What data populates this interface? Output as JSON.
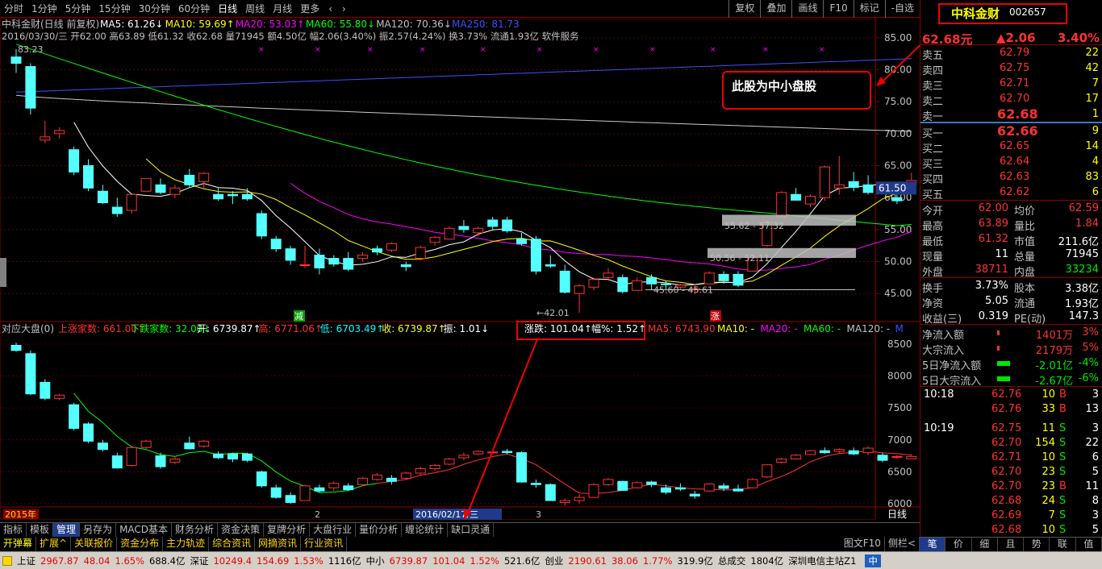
{
  "toolbar": {
    "timeframes": [
      "分时",
      "1分钟",
      "5分钟",
      "15分钟",
      "30分钟",
      "60分钟",
      "日线",
      "周线",
      "月线",
      "更多"
    ],
    "active": "日线",
    "right_buttons": [
      "复权",
      "叠加",
      "画线",
      "F10",
      "标记",
      "-自选"
    ]
  },
  "main_chart": {
    "title": "中科金财(日线 前复权)",
    "ma_labels": [
      {
        "text": "MA5: 61.26",
        "arrow": "↓",
        "color": "#ffffff"
      },
      {
        "text": "MA10: 59.69",
        "arrow": "↑",
        "color": "#ffff00"
      },
      {
        "text": "MA20: 53.03",
        "arrow": "↑",
        "color": "#ff00ff"
      },
      {
        "text": "MA60: 55.80",
        "arrow": "↓",
        "color": "#00ff00"
      },
      {
        "text": "MA120: 70.36",
        "arrow": "↓",
        "color": "#c0c0c0"
      },
      {
        "text": "MA250: 81.73",
        "arrow": "",
        "color": "#3c50ff"
      }
    ],
    "info_line": "2016/03/30/三 开62.00 高63.89 低61.32 收62.68 量71945 额4.50亿 幅2.06(3.40%) 振2.57(4.24%) 换3.73% 流通1.93亿 软件服务",
    "y_ticks": [
      "85.00",
      "80.00",
      "75.00",
      "70.00",
      "65.00",
      "60.00",
      "55.00",
      "50.00",
      "45.00"
    ],
    "price_tag": "61.50",
    "annotations": [
      "83.23",
      "42.01",
      "45.60 - 45.61",
      "50.56 - 52.11",
      "55.62 - 57.32"
    ],
    "markers": [
      "减",
      "涨"
    ],
    "callout": "此股为中小盘股"
  },
  "sub_chart": {
    "title": "对应大盘(0)",
    "stats": [
      {
        "text": "上涨家数: 661.00",
        "arrow": "↑",
        "color": "#ff3232"
      },
      {
        "text": "下跌家数: 32.00",
        "arrow": "↓",
        "color": "#00ff00"
      },
      {
        "text": "开: 6739.87",
        "arrow": "↑",
        "color": "#ffffff"
      },
      {
        "text": "高: 6771.06",
        "arrow": "↑",
        "color": "#ff3232"
      },
      {
        "text": "低: 6703.49",
        "arrow": "↑",
        "color": "#00ffff"
      },
      {
        "text": "收: 6739.87",
        "arrow": "↑",
        "color": "#ffff00"
      },
      {
        "text": "振: 1.01",
        "arrow": "↓",
        "color": "#ffffff"
      }
    ],
    "highlight": {
      "change": "涨跌: 101.04",
      "change_arrow": "↑",
      "pct": "幅%: 1.52",
      "pct_arrow": "↑"
    },
    "ma_labels": [
      {
        "text": "MA5: 6743.90",
        "color": "#ff3232"
      },
      {
        "text": "MA10: -",
        "color": "#ffff00"
      },
      {
        "text": "MA20: -",
        "color": "#ff00ff"
      },
      {
        "text": "MA60: -",
        "color": "#00ff00"
      },
      {
        "text": "MA120: -",
        "color": "#c0c0c0"
      },
      {
        "text": "M",
        "color": "#3c50ff"
      }
    ],
    "y_ticks": [
      "8500",
      "8000",
      "7500",
      "7000",
      "6500",
      "6000"
    ]
  },
  "x_axis": {
    "labels": [
      "2015年",
      "2",
      "2016/02/17/三",
      "3"
    ],
    "period": "日线"
  },
  "bottom_tabs": [
    "指标",
    "模板",
    "管理",
    "另存为",
    "MACD基本",
    "财务分析",
    "资金决策",
    "复牌分析",
    "大盘行业",
    "量价分析",
    "缠论统计",
    "缺口灵通"
  ],
  "bottom_tabs_active": "管理",
  "bottom_tabs2": [
    "开弹幕",
    "扩展^",
    "关联报价",
    "资金分布",
    "主力轨迹",
    "综合资讯",
    "网摘资讯",
    "行业资讯"
  ],
  "bottom_tabs2_right": [
    "图文F10",
    "侧栏<"
  ],
  "side_tabs": [
    "笔",
    "价",
    "细",
    "且",
    "势",
    "联",
    "值"
  ],
  "side_tabs_active": "笔",
  "side": {
    "name": "中科金财",
    "code": "002657",
    "price": "62.68元",
    "change": "▲2.06",
    "pct": "3.40%",
    "asks": [
      {
        "label": "卖五",
        "price": "62.79",
        "vol": "22"
      },
      {
        "label": "卖四",
        "price": "62.75",
        "vol": "42"
      },
      {
        "label": "卖三",
        "price": "62.71",
        "vol": "7"
      },
      {
        "label": "卖二",
        "price": "62.70",
        "vol": "17"
      },
      {
        "label": "卖一",
        "price": "62.68",
        "vol": "1"
      }
    ],
    "bids": [
      {
        "label": "买一",
        "price": "62.66",
        "vol": "9"
      },
      {
        "label": "买二",
        "price": "62.65",
        "vol": "14"
      },
      {
        "label": "买三",
        "price": "62.64",
        "vol": "4"
      },
      {
        "label": "买四",
        "price": "62.63",
        "vol": "83"
      },
      {
        "label": "买五",
        "price": "62.62",
        "vol": "6"
      }
    ],
    "stats": [
      {
        "l1": "今开",
        "v1": "62.00",
        "l2": "均价",
        "v2": "62.59",
        "c1": "red",
        "c2": "red"
      },
      {
        "l1": "最高",
        "v1": "63.89",
        "l2": "量比",
        "v2": "1.84",
        "c1": "red",
        "c2": "red"
      },
      {
        "l1": "最低",
        "v1": "61.32",
        "l2": "市值",
        "v2": "211.6亿",
        "c1": "red",
        "c2": "wht"
      },
      {
        "l1": "现量",
        "v1": "11",
        "l2": "总量",
        "v2": "71945",
        "c1": "wht",
        "c2": "wht"
      },
      {
        "l1": "外盘",
        "v1": "38711",
        "l2": "内盘",
        "v2": "33234",
        "c1": "red",
        "c2": "grn"
      }
    ],
    "stats2": [
      {
        "l1": "换手",
        "v1": "3.73%",
        "l2": "股本",
        "v2": "3.38亿"
      },
      {
        "l1": "净资",
        "v1": "5.05",
        "l2": "流通",
        "v2": "1.93亿"
      },
      {
        "l1": "收益(三)",
        "v1": "0.319",
        "l2": "PE(动)",
        "v2": "147.3"
      }
    ],
    "flows": [
      {
        "label": "净流入额",
        "value": "1401万",
        "pct": "3%",
        "color": "#ff3232"
      },
      {
        "label": "大宗流入",
        "value": "2179万",
        "pct": "5%",
        "color": "#ff3232"
      },
      {
        "label": "5日净流入额",
        "value": "-2.01亿",
        "pct": "-4%",
        "color": "#00e600"
      },
      {
        "label": "5日大宗流入",
        "value": "-2.67亿",
        "pct": "-6%",
        "color": "#00e600"
      }
    ],
    "trades": [
      {
        "time": "10:18",
        "price": "62.76",
        "vol": "10",
        "side": "B",
        "n": "3"
      },
      {
        "time": "",
        "price": "62.76",
        "vol": "33",
        "side": "B",
        "n": "13"
      },
      {
        "time": "10:19",
        "price": "62.75",
        "vol": "11",
        "side": "S",
        "n": "3"
      },
      {
        "time": "",
        "price": "62.70",
        "vol": "154",
        "side": "S",
        "n": "22"
      },
      {
        "time": "",
        "price": "62.71",
        "vol": "10",
        "side": "S",
        "n": "6"
      },
      {
        "time": "",
        "price": "62.70",
        "vol": "23",
        "side": "S",
        "n": "5"
      },
      {
        "time": "",
        "price": "62.70",
        "vol": "23",
        "side": "B",
        "n": "11"
      },
      {
        "time": "",
        "price": "62.68",
        "vol": "24",
        "side": "S",
        "n": "8"
      },
      {
        "time": "",
        "price": "62.69",
        "vol": "7",
        "side": "S",
        "n": "3"
      },
      {
        "time": "",
        "price": "62.68",
        "vol": "10",
        "side": "S",
        "n": "5"
      }
    ]
  },
  "status": {
    "sh": {
      "label": "上证",
      "price": "2967.87",
      "chg": "48.04",
      "pct": "1.65%",
      "amt": "688.4亿"
    },
    "sz": {
      "label": "深证",
      "price": "10249.4",
      "chg": "154.69",
      "pct": "1.53%",
      "amt": "1116亿"
    },
    "zx": {
      "label": "中小",
      "price": "6739.87",
      "chg": "101.04",
      "pct": "1.52%",
      "amt": "521.6亿"
    },
    "cy": {
      "label": "创业",
      "price": "2190.61",
      "chg": "38.06",
      "pct": "1.77%",
      "amt": "319.9亿"
    },
    "total_label": "总成交",
    "total": "1804亿",
    "server": "深圳电信主站Z1",
    "ime": "中"
  },
  "colors": {
    "up": "#ff3232",
    "down": "#54ffff",
    "grid": "#8b0000",
    "bg": "#000000"
  },
  "chart_data": [
    {
      "type": "candlestick",
      "name": "中科金财 日线",
      "ylim": [
        42,
        87
      ],
      "candles": [
        [
          82.0,
          83.23,
          79.5,
          81.0
        ],
        [
          80.5,
          81.0,
          73.0,
          74.0
        ],
        [
          69.0,
          72.0,
          68.5,
          69.5
        ],
        [
          70.0,
          71.0,
          69.2,
          70.5
        ],
        [
          67.5,
          68.0,
          63.5,
          64.0
        ],
        [
          65.0,
          66.0,
          61.0,
          61.5
        ],
        [
          61.0,
          62.0,
          59.0,
          59.2
        ],
        [
          58.5,
          60.0,
          57.0,
          57.5
        ],
        [
          58.0,
          60.5,
          57.5,
          60.5
        ],
        [
          61.0,
          63.0,
          61.0,
          63.0
        ],
        [
          62.0,
          63.0,
          60.5,
          60.8
        ],
        [
          60.5,
          62.0,
          60.0,
          61.5
        ],
        [
          63.5,
          64.5,
          61.5,
          62.0
        ],
        [
          62.5,
          64.0,
          61.5,
          63.8
        ],
        [
          60.5,
          61.5,
          59.5,
          59.8
        ],
        [
          60.5,
          61.0,
          59.0,
          60.3
        ],
        [
          60.5,
          61.5,
          59.5,
          59.8
        ],
        [
          57.5,
          58.0,
          53.5,
          54.0
        ],
        [
          53.5,
          54.0,
          51.5,
          52.0
        ],
        [
          52.0,
          52.5,
          49.5,
          50.2
        ],
        [
          49.5,
          52.5,
          49.0,
          49.5
        ],
        [
          51.0,
          52.0,
          48.0,
          49.0
        ],
        [
          50.5,
          51.0,
          49.2,
          49.6
        ],
        [
          50.5,
          51.5,
          48.5,
          48.8
        ],
        [
          50.5,
          51.5,
          50.0,
          51.0
        ],
        [
          52.0,
          52.5,
          51.0,
          51.5
        ],
        [
          51.8,
          53.0,
          51.5,
          52.8
        ],
        [
          49.5,
          50.0,
          48.5,
          49.2
        ],
        [
          50.5,
          52.5,
          50.5,
          52.2
        ],
        [
          53.0,
          54.0,
          52.5,
          53.8
        ],
        [
          53.5,
          55.5,
          53.5,
          55.2
        ],
        [
          55.5,
          56.5,
          54.5,
          55.0
        ],
        [
          54.5,
          55.5,
          54.0,
          55.2
        ],
        [
          56.5,
          57.0,
          55.0,
          55.5
        ],
        [
          56.5,
          57.0,
          54.5,
          54.8
        ],
        [
          53.5,
          54.5,
          52.5,
          52.8
        ],
        [
          53.5,
          54.0,
          48.0,
          48.5
        ],
        [
          49.5,
          51.0,
          49.0,
          49.3
        ],
        [
          48.5,
          49.5,
          45.0,
          45.2
        ],
        [
          45.0,
          46.5,
          42.01,
          46.2
        ],
        [
          46.0,
          47.5,
          45.5,
          47.2
        ],
        [
          47.5,
          49.0,
          47.0,
          48.2
        ],
        [
          47.5,
          48.0,
          45.0,
          45.3
        ],
        [
          45.5,
          47.5,
          45.5,
          47.0
        ],
        [
          47.5,
          48.0,
          45.5,
          46.5
        ],
        [
          46.5,
          47.0,
          45.5,
          46.4
        ],
        [
          46.0,
          46.5,
          45.61,
          46.3
        ],
        [
          45.6,
          46.5,
          45.0,
          45.8
        ],
        [
          46.5,
          48.5,
          46.5,
          48.2
        ],
        [
          48.0,
          48.5,
          46.5,
          47.0
        ],
        [
          48.0,
          48.5,
          46.0,
          46.3
        ],
        [
          48.5,
          50.8,
          48.5,
          50.6
        ],
        [
          52.5,
          56.5,
          52.3,
          56.2
        ],
        [
          57.0,
          61.0,
          57.0,
          60.8
        ],
        [
          60.5,
          61.5,
          59.5,
          59.6
        ],
        [
          59.0,
          60.5,
          58.5,
          60.2
        ],
        [
          60.0,
          65.0,
          59.5,
          64.8
        ],
        [
          61.5,
          66.5,
          60.5,
          62.0
        ],
        [
          62.5,
          64.0,
          61.0,
          61.6
        ],
        [
          62.0,
          63.5,
          60.5,
          60.8
        ],
        [
          61.5,
          62.5,
          60.5,
          61.4
        ],
        [
          60.0,
          61.0,
          59.0,
          59.5
        ],
        [
          62.0,
          63.89,
          61.32,
          62.68
        ]
      ],
      "ma": {
        "MA5": 61.26,
        "MA10": 59.69,
        "MA20": 53.03,
        "MA60": 55.8,
        "MA120": 70.36,
        "MA250": 81.73
      }
    },
    {
      "type": "candlestick",
      "name": "对应大盘 中小板指",
      "ylim": [
        5950,
        8650
      ],
      "candles": [
        [
          8480,
          8520,
          8380,
          8400
        ],
        [
          8350,
          8400,
          7700,
          7720
        ],
        [
          7900,
          7950,
          7620,
          7650
        ],
        [
          7650,
          7720,
          7620,
          7700
        ],
        [
          7550,
          7580,
          7150,
          7180
        ],
        [
          7250,
          7280,
          6950,
          6980
        ],
        [
          6950,
          7000,
          6820,
          6850
        ],
        [
          6750,
          6800,
          6550,
          6560
        ],
        [
          6600,
          6900,
          6580,
          6880
        ],
        [
          6880,
          7000,
          6860,
          6980
        ],
        [
          6750,
          6800,
          6550,
          6580
        ],
        [
          6650,
          6750,
          6620,
          6700
        ],
        [
          6950,
          7050,
          6850,
          6860
        ],
        [
          6900,
          7000,
          6880,
          6980
        ],
        [
          6780,
          6820,
          6700,
          6720
        ],
        [
          6780,
          6800,
          6650,
          6700
        ],
        [
          6780,
          6800,
          6650,
          6680
        ],
        [
          6500,
          6520,
          6250,
          6280
        ],
        [
          6250,
          6300,
          6080,
          6100
        ],
        [
          6130,
          6180,
          6000,
          6020
        ],
        [
          6050,
          6300,
          6050,
          6280
        ],
        [
          6250,
          6300,
          6180,
          6200
        ],
        [
          6250,
          6350,
          6200,
          6320
        ],
        [
          6280,
          6320,
          6200,
          6220
        ],
        [
          6300,
          6420,
          6280,
          6400
        ],
        [
          6380,
          6480,
          6360,
          6450
        ],
        [
          6400,
          6450,
          6300,
          6350
        ],
        [
          6400,
          6500,
          6380,
          6480
        ],
        [
          6480,
          6580,
          6450,
          6550
        ],
        [
          6550,
          6620,
          6520,
          6600
        ],
        [
          6620,
          6720,
          6600,
          6700
        ],
        [
          6720,
          6800,
          6680,
          6760
        ],
        [
          6780,
          6840,
          6760,
          6820
        ],
        [
          6800,
          6840,
          6780,
          6810
        ],
        [
          6820,
          6860,
          6780,
          6800
        ],
        [
          6800,
          6820,
          6330,
          6340
        ],
        [
          6320,
          6380,
          6250,
          6300
        ],
        [
          6300,
          6320,
          6050,
          6050
        ],
        [
          6020,
          6080,
          5970,
          6050
        ],
        [
          6050,
          6150,
          6000,
          6100
        ],
        [
          6100,
          6320,
          6090,
          6300
        ],
        [
          6300,
          6400,
          6280,
          6380
        ],
        [
          6350,
          6360,
          6200,
          6210
        ],
        [
          6250,
          6350,
          6240,
          6330
        ],
        [
          6340,
          6360,
          6260,
          6300
        ],
        [
          6250,
          6300,
          6150,
          6180
        ],
        [
          6250,
          6320,
          6200,
          6230
        ],
        [
          6150,
          6200,
          6080,
          6120
        ],
        [
          6200,
          6320,
          6190,
          6310
        ],
        [
          6280,
          6320,
          6200,
          6240
        ],
        [
          6230,
          6300,
          6190,
          6200
        ],
        [
          6250,
          6400,
          6240,
          6380
        ],
        [
          6420,
          6620,
          6400,
          6610
        ],
        [
          6650,
          6720,
          6630,
          6700
        ],
        [
          6700,
          6780,
          6690,
          6760
        ],
        [
          6770,
          6840,
          6760,
          6830
        ],
        [
          6830,
          6880,
          6780,
          6800
        ],
        [
          6820,
          6870,
          6790,
          6850
        ],
        [
          6830,
          6880,
          6760,
          6780
        ],
        [
          6800,
          6900,
          6760,
          6870
        ],
        [
          6760,
          6800,
          6650,
          6680
        ],
        [
          6730,
          6760,
          6700,
          6740
        ],
        [
          6703.49,
          6771.06,
          6703.49,
          6739.87
        ]
      ]
    }
  ]
}
